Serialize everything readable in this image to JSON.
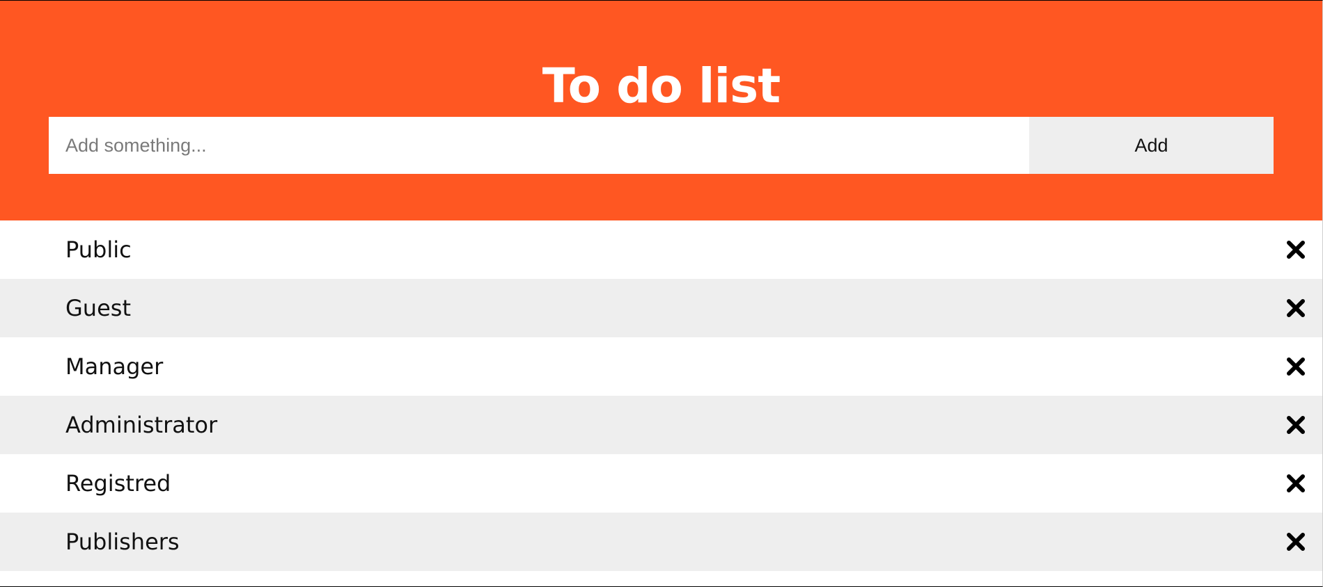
{
  "header": {
    "title": "To do list",
    "background_color": "#ff5722"
  },
  "input": {
    "placeholder": "Add something...",
    "value": ""
  },
  "add_button": {
    "label": "Add"
  },
  "items": [
    {
      "label": "Public",
      "icon": "close-icon"
    },
    {
      "label": "Guest",
      "icon": "close-icon"
    },
    {
      "label": "Manager",
      "icon": "close-icon"
    },
    {
      "label": "Administrator",
      "icon": "close-icon"
    },
    {
      "label": "Registred",
      "icon": "close-icon"
    },
    {
      "label": "Publishers",
      "icon": "close-icon"
    }
  ]
}
